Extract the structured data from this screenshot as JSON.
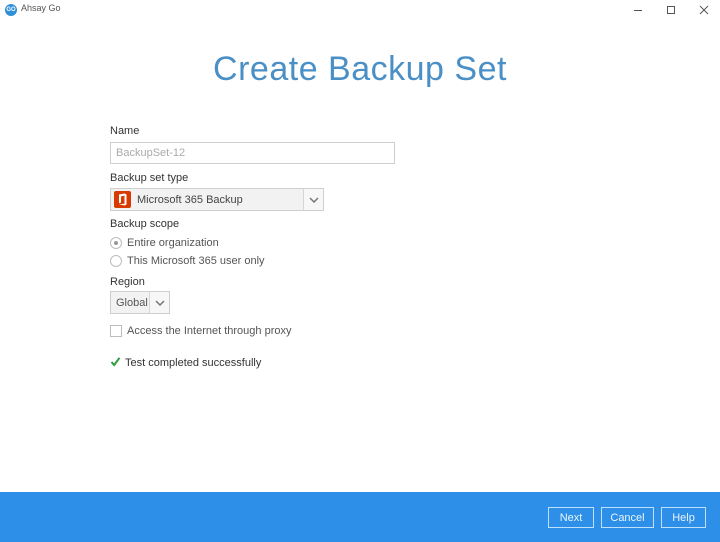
{
  "window": {
    "app_title": "Ahsay Go",
    "app_icon_text": "GO",
    "icons": {
      "minimize": "minimize-icon",
      "maximize": "maximize-icon",
      "close": "close-icon"
    }
  },
  "page": {
    "title": "Create Backup Set"
  },
  "form": {
    "name_label": "Name",
    "name_placeholder": "BackupSet-12",
    "type_label": "Backup set type",
    "type_value": "Microsoft 365 Backup",
    "type_icon": "microsoft-office-icon",
    "scope_label": "Backup scope",
    "scope_options": [
      {
        "label": "Entire organization",
        "checked": true
      },
      {
        "label": "This Microsoft 365 user only",
        "checked": false
      }
    ],
    "region_label": "Region",
    "region_value": "Global",
    "proxy_label": "Access the Internet through proxy",
    "proxy_checked": false,
    "status_text": "Test completed successfully",
    "status_icon": "checkmark-icon"
  },
  "footer": {
    "next_label": "Next",
    "cancel_label": "Cancel",
    "help_label": "Help"
  },
  "colors": {
    "accent": "#2e8fe8",
    "title": "#4a90c6",
    "success": "#2e9e3e",
    "office": "#d83b01"
  }
}
